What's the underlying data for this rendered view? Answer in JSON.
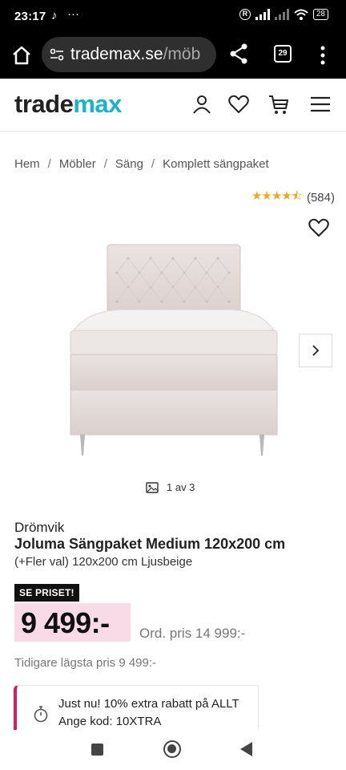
{
  "status_bar": {
    "time": "23:17",
    "dots": "···",
    "battery": "28"
  },
  "browser": {
    "url_domain": "trademax.se",
    "url_path": "/möb",
    "tab_count": "29"
  },
  "header": {
    "logo_part1": "trade",
    "logo_part2": "max",
    "logo_accent_color": "#1ab3c8"
  },
  "breadcrumb": [
    "Hem",
    "Möbler",
    "Säng",
    "Komplett sängpaket"
  ],
  "rating": {
    "value": 4.5,
    "max": 5,
    "count": "(584)"
  },
  "gallery": {
    "counter": "1 av 3"
  },
  "product": {
    "brand": "Drömvik",
    "title": "Joluma Sängpaket Medium 120x200 cm",
    "variant": "(+Fler val) 120x200 cm Ljusbeige",
    "badge": "SE PRISET!",
    "price": "9 499:-",
    "ord_price": "Ord. pris 14 999:-",
    "lowest_price": "Tidigare lägsta pris 9 499:-",
    "price_bg_color": "#f9dbe8"
  },
  "promo": {
    "line1": "Just nu! 10% extra rabatt på ALLT",
    "line2": "Ange kod: 10XTRA",
    "accent_color": "#e2185b"
  }
}
